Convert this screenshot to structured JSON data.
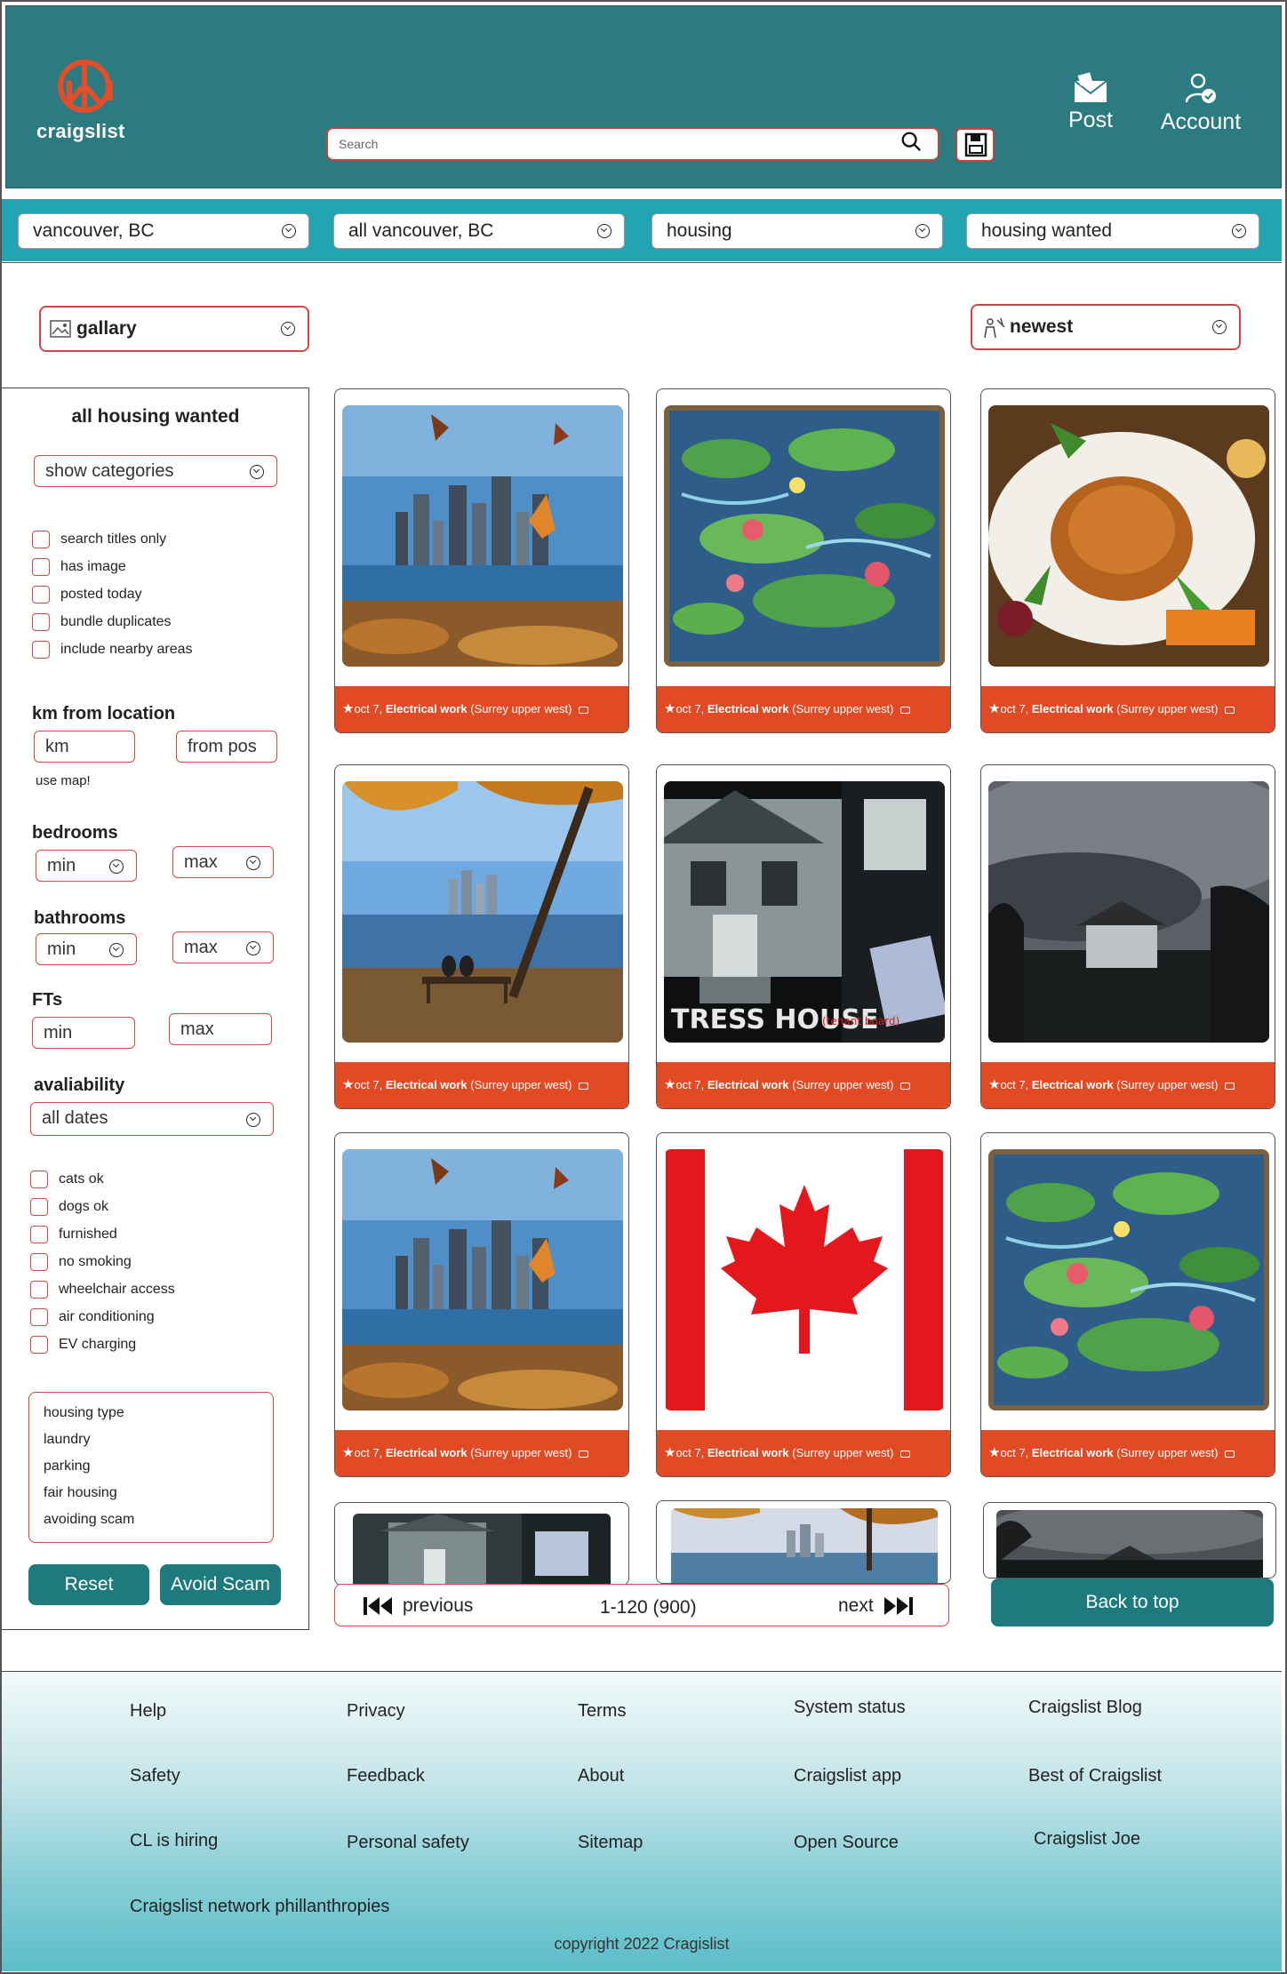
{
  "header": {
    "brand": "craigslist",
    "search_placeholder": "Search",
    "post_label": "Post",
    "account_label": "Account"
  },
  "filters": {
    "location": "vancouver, BC",
    "area": "all vancouver, BC",
    "category": "housing",
    "subcategory": "housing wanted"
  },
  "view": {
    "mode": "gallary",
    "sort": "newest"
  },
  "sidebar": {
    "title": "all housing wanted",
    "categories_label": "show categories",
    "checkboxes_top": [
      "search titles only",
      "has image",
      "posted today",
      "bundle duplicates",
      "include nearby areas"
    ],
    "km_heading": "km from location",
    "km_placeholder": "km",
    "from_placeholder": "from pos",
    "use_map": "use map!",
    "bedrooms_heading": "bedrooms",
    "bathrooms_heading": "bathrooms",
    "fts_heading": "FTs",
    "min_label": "min",
    "max_label": "max",
    "availability_heading": "avaliability",
    "availability_value": "all dates",
    "checkboxes_bottom": [
      "cats ok",
      "dogs ok",
      "furnished",
      "no smoking",
      "wheelchair access",
      "air conditioning",
      "EV charging"
    ],
    "links": [
      "housing type",
      "laundry",
      "parking",
      "fair housing",
      "avoiding scam"
    ],
    "reset_label": "Reset",
    "avoid_scam_label": "Avoid Scam"
  },
  "listings": [
    {
      "date": "oct 7,",
      "title": "Electrical work",
      "location": "(Surrey upper west)",
      "image": "city-autumn"
    },
    {
      "date": "oct 7,",
      "title": "Electrical work",
      "location": "(Surrey upper west)",
      "image": "lily-painting"
    },
    {
      "date": "oct 7,",
      "title": "Electrical work",
      "location": "(Surrey upper west)",
      "image": "roast-turkey"
    },
    {
      "date": "oct 7,",
      "title": "Electrical work",
      "location": "(Surrey upper west)",
      "image": "park-bench"
    },
    {
      "date": "oct 7,",
      "title": "Electrical work",
      "location": "(Surrey upper west)",
      "image": "stress-house"
    },
    {
      "date": "oct 7,",
      "title": "Electrical work",
      "location": "(Surrey upper west)",
      "image": "dusk-house"
    },
    {
      "date": "oct 7,",
      "title": "Electrical work",
      "location": "(Surrey upper west)",
      "image": "city-autumn"
    },
    {
      "date": "oct 7,",
      "title": "Electrical work",
      "location": "(Surrey upper west)",
      "image": "canada-flag"
    },
    {
      "date": "oct 7,",
      "title": "Electrical work",
      "location": "(Surrey upper west)",
      "image": "lily-painting"
    }
  ],
  "stress_house_caption": "TRESS HOUSE",
  "stress_house_caption2": "(tenant board)",
  "pager": {
    "previous": "previous",
    "range": "1-120 (900)",
    "next": "next"
  },
  "back_to_top": "Back to top",
  "footer": {
    "col1": [
      "Help",
      "Safety",
      "CL is hiring"
    ],
    "col2": [
      "Privacy",
      "Feedback",
      "Personal safety"
    ],
    "col3": [
      "Terms",
      "About",
      "Sitemap"
    ],
    "col4": [
      "System status",
      "Craigslist app",
      "Open Source"
    ],
    "col5": [
      "Craigslist Blog",
      "Best of Craigslist",
      "Craigslist Joe"
    ],
    "philanthropies": "Craigslist network phillanthropies",
    "copyright": "copyright 2022 Cragislist"
  },
  "colors": {
    "header_bg": "#2b7b80",
    "filterbar_bg": "#22a4b3",
    "accent_red": "#e04a25",
    "border_red": "#d14545",
    "button_teal": "#1f7a7e"
  }
}
